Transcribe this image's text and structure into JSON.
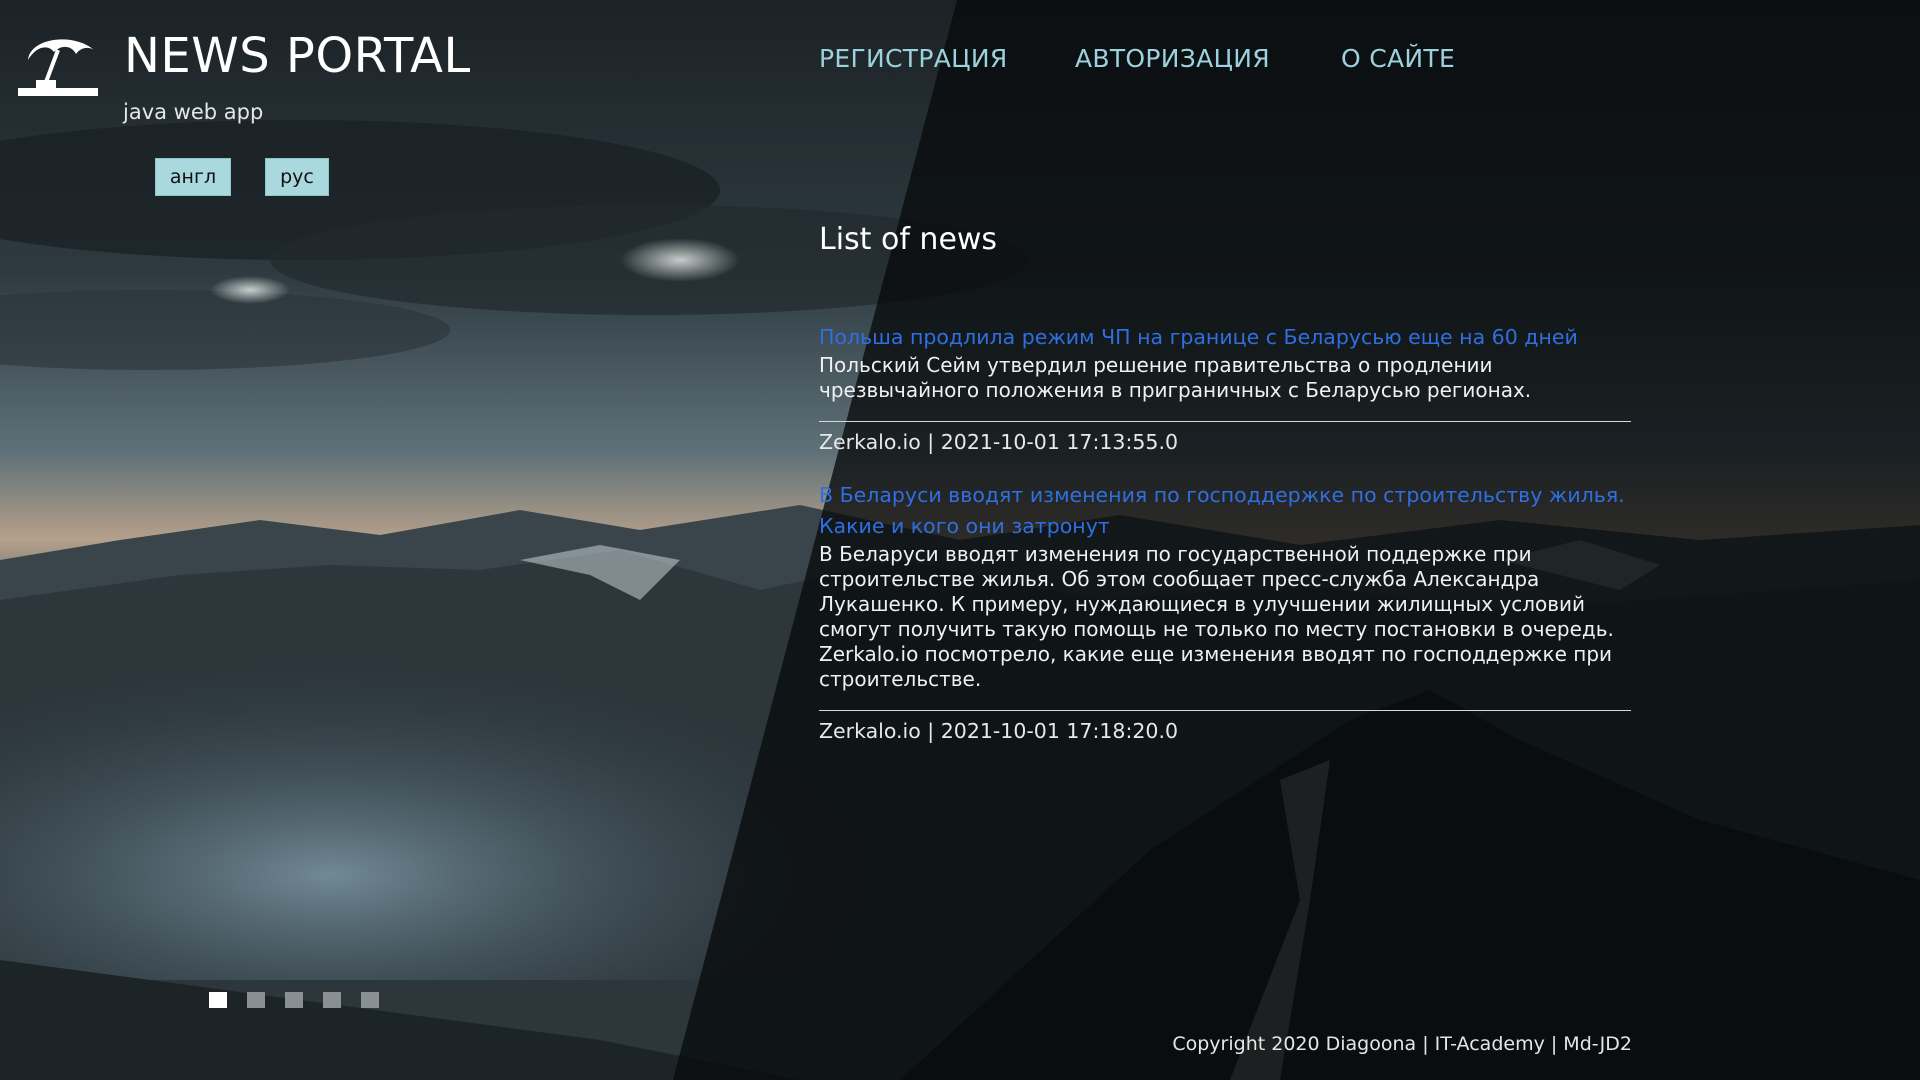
{
  "header": {
    "title": "NEWS PORTAL",
    "subtitle": "java web app",
    "logo_icon": "umbrella-icon"
  },
  "language": {
    "english": "англ",
    "russian": "рус"
  },
  "nav": {
    "registration": "РЕГИСТРАЦИЯ",
    "authorization": "АВТОРИЗАЦИЯ",
    "about": "О САЙТЕ"
  },
  "news": {
    "heading": "List of news",
    "items": [
      {
        "title": "Польша продлила режим ЧП на границе с Беларусью еще на 60 дней",
        "brief": "Польский Сейм утвердил решение правительства о продлении чрезвычайного положения в приграничных с Беларусью регионах.",
        "meta": "Zerkalo.io | 2021-10-01 17:13:55.0"
      },
      {
        "title": "В Беларуси вводят изменения по господдержке по строительству жилья. Какие и кого они затронут",
        "brief": "В Беларуси вводят изменения по государственной поддержке при строительстве жилья. Об этом сообщает пресс-служба Александра Лукашенко. К примеру, нуждающиеся в улучшении жилищных условий смогут получить такую помощь не только по месту постановки в очередь. Zerkalo.io посмотрело, какие еще изменения вводят по господдержке при строительстве.",
        "meta": "Zerkalo.io | 2021-10-01 17:18:20.0"
      }
    ]
  },
  "slider": {
    "count": 5,
    "active_index": 0
  },
  "footer": {
    "copyright": "Copyright 2020 Diagoona | IT-Academy | Md-JD2"
  },
  "colors": {
    "nav": "#9bd2dd",
    "news_title": "#2f6fe0",
    "lang_button": "#a9d9dd"
  }
}
